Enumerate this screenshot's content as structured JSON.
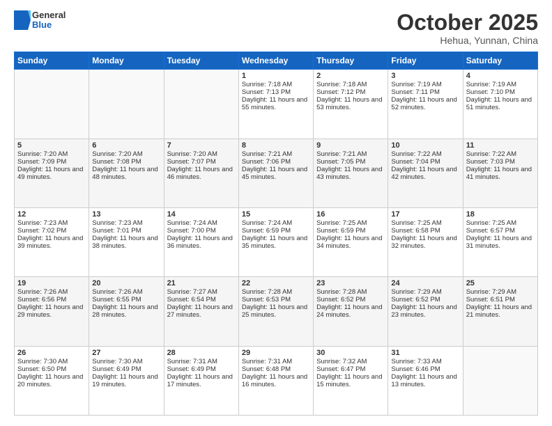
{
  "header": {
    "logo_general": "General",
    "logo_blue": "Blue",
    "month_title": "October 2025",
    "location": "Hehua, Yunnan, China"
  },
  "days_of_week": [
    "Sunday",
    "Monday",
    "Tuesday",
    "Wednesday",
    "Thursday",
    "Friday",
    "Saturday"
  ],
  "weeks": [
    [
      {
        "day": "",
        "sunrise": "",
        "sunset": "",
        "daylight": ""
      },
      {
        "day": "",
        "sunrise": "",
        "sunset": "",
        "daylight": ""
      },
      {
        "day": "",
        "sunrise": "",
        "sunset": "",
        "daylight": ""
      },
      {
        "day": "1",
        "sunrise": "Sunrise: 7:18 AM",
        "sunset": "Sunset: 7:13 PM",
        "daylight": "Daylight: 11 hours and 55 minutes."
      },
      {
        "day": "2",
        "sunrise": "Sunrise: 7:18 AM",
        "sunset": "Sunset: 7:12 PM",
        "daylight": "Daylight: 11 hours and 53 minutes."
      },
      {
        "day": "3",
        "sunrise": "Sunrise: 7:19 AM",
        "sunset": "Sunset: 7:11 PM",
        "daylight": "Daylight: 11 hours and 52 minutes."
      },
      {
        "day": "4",
        "sunrise": "Sunrise: 7:19 AM",
        "sunset": "Sunset: 7:10 PM",
        "daylight": "Daylight: 11 hours and 51 minutes."
      }
    ],
    [
      {
        "day": "5",
        "sunrise": "Sunrise: 7:20 AM",
        "sunset": "Sunset: 7:09 PM",
        "daylight": "Daylight: 11 hours and 49 minutes."
      },
      {
        "day": "6",
        "sunrise": "Sunrise: 7:20 AM",
        "sunset": "Sunset: 7:08 PM",
        "daylight": "Daylight: 11 hours and 48 minutes."
      },
      {
        "day": "7",
        "sunrise": "Sunrise: 7:20 AM",
        "sunset": "Sunset: 7:07 PM",
        "daylight": "Daylight: 11 hours and 46 minutes."
      },
      {
        "day": "8",
        "sunrise": "Sunrise: 7:21 AM",
        "sunset": "Sunset: 7:06 PM",
        "daylight": "Daylight: 11 hours and 45 minutes."
      },
      {
        "day": "9",
        "sunrise": "Sunrise: 7:21 AM",
        "sunset": "Sunset: 7:05 PM",
        "daylight": "Daylight: 11 hours and 43 minutes."
      },
      {
        "day": "10",
        "sunrise": "Sunrise: 7:22 AM",
        "sunset": "Sunset: 7:04 PM",
        "daylight": "Daylight: 11 hours and 42 minutes."
      },
      {
        "day": "11",
        "sunrise": "Sunrise: 7:22 AM",
        "sunset": "Sunset: 7:03 PM",
        "daylight": "Daylight: 11 hours and 41 minutes."
      }
    ],
    [
      {
        "day": "12",
        "sunrise": "Sunrise: 7:23 AM",
        "sunset": "Sunset: 7:02 PM",
        "daylight": "Daylight: 11 hours and 39 minutes."
      },
      {
        "day": "13",
        "sunrise": "Sunrise: 7:23 AM",
        "sunset": "Sunset: 7:01 PM",
        "daylight": "Daylight: 11 hours and 38 minutes."
      },
      {
        "day": "14",
        "sunrise": "Sunrise: 7:24 AM",
        "sunset": "Sunset: 7:00 PM",
        "daylight": "Daylight: 11 hours and 36 minutes."
      },
      {
        "day": "15",
        "sunrise": "Sunrise: 7:24 AM",
        "sunset": "Sunset: 6:59 PM",
        "daylight": "Daylight: 11 hours and 35 minutes."
      },
      {
        "day": "16",
        "sunrise": "Sunrise: 7:25 AM",
        "sunset": "Sunset: 6:59 PM",
        "daylight": "Daylight: 11 hours and 34 minutes."
      },
      {
        "day": "17",
        "sunrise": "Sunrise: 7:25 AM",
        "sunset": "Sunset: 6:58 PM",
        "daylight": "Daylight: 11 hours and 32 minutes."
      },
      {
        "day": "18",
        "sunrise": "Sunrise: 7:25 AM",
        "sunset": "Sunset: 6:57 PM",
        "daylight": "Daylight: 11 hours and 31 minutes."
      }
    ],
    [
      {
        "day": "19",
        "sunrise": "Sunrise: 7:26 AM",
        "sunset": "Sunset: 6:56 PM",
        "daylight": "Daylight: 11 hours and 29 minutes."
      },
      {
        "day": "20",
        "sunrise": "Sunrise: 7:26 AM",
        "sunset": "Sunset: 6:55 PM",
        "daylight": "Daylight: 11 hours and 28 minutes."
      },
      {
        "day": "21",
        "sunrise": "Sunrise: 7:27 AM",
        "sunset": "Sunset: 6:54 PM",
        "daylight": "Daylight: 11 hours and 27 minutes."
      },
      {
        "day": "22",
        "sunrise": "Sunrise: 7:28 AM",
        "sunset": "Sunset: 6:53 PM",
        "daylight": "Daylight: 11 hours and 25 minutes."
      },
      {
        "day": "23",
        "sunrise": "Sunrise: 7:28 AM",
        "sunset": "Sunset: 6:52 PM",
        "daylight": "Daylight: 11 hours and 24 minutes."
      },
      {
        "day": "24",
        "sunrise": "Sunrise: 7:29 AM",
        "sunset": "Sunset: 6:52 PM",
        "daylight": "Daylight: 11 hours and 23 minutes."
      },
      {
        "day": "25",
        "sunrise": "Sunrise: 7:29 AM",
        "sunset": "Sunset: 6:51 PM",
        "daylight": "Daylight: 11 hours and 21 minutes."
      }
    ],
    [
      {
        "day": "26",
        "sunrise": "Sunrise: 7:30 AM",
        "sunset": "Sunset: 6:50 PM",
        "daylight": "Daylight: 11 hours and 20 minutes."
      },
      {
        "day": "27",
        "sunrise": "Sunrise: 7:30 AM",
        "sunset": "Sunset: 6:49 PM",
        "daylight": "Daylight: 11 hours and 19 minutes."
      },
      {
        "day": "28",
        "sunrise": "Sunrise: 7:31 AM",
        "sunset": "Sunset: 6:49 PM",
        "daylight": "Daylight: 11 hours and 17 minutes."
      },
      {
        "day": "29",
        "sunrise": "Sunrise: 7:31 AM",
        "sunset": "Sunset: 6:48 PM",
        "daylight": "Daylight: 11 hours and 16 minutes."
      },
      {
        "day": "30",
        "sunrise": "Sunrise: 7:32 AM",
        "sunset": "Sunset: 6:47 PM",
        "daylight": "Daylight: 11 hours and 15 minutes."
      },
      {
        "day": "31",
        "sunrise": "Sunrise: 7:33 AM",
        "sunset": "Sunset: 6:46 PM",
        "daylight": "Daylight: 11 hours and 13 minutes."
      },
      {
        "day": "",
        "sunrise": "",
        "sunset": "",
        "daylight": ""
      }
    ]
  ]
}
